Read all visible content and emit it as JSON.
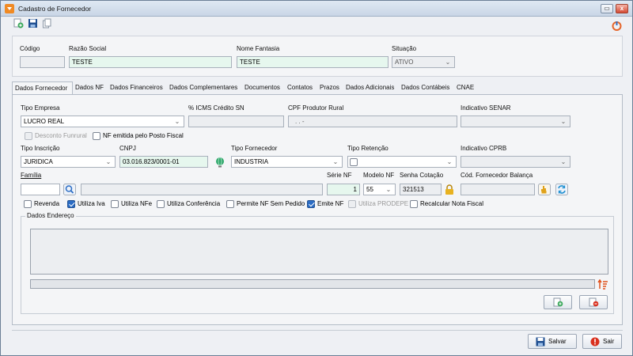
{
  "window": {
    "title": "Cadastro de Fornecedor",
    "restore_label": "▭",
    "close_label": "x"
  },
  "header": {
    "codigo": {
      "label": "Código",
      "value": ""
    },
    "razao": {
      "label": "Razão Social",
      "value": "TESTE"
    },
    "fantasia": {
      "label": "Nome Fantasia",
      "value": "TESTE"
    },
    "situacao": {
      "label": "Situação",
      "value": "ATIVO"
    }
  },
  "tabs": [
    "Dados Fornecedor",
    "Dados NF",
    "Dados Financeiros",
    "Dados Complementares",
    "Documentos",
    "Contatos",
    "Prazos",
    "Dados Adicionais",
    "Dados Contábeis",
    "CNAE"
  ],
  "form": {
    "tipo_empresa": {
      "label": "Tipo Empresa",
      "value": "LUCRO REAL"
    },
    "icms": {
      "label": "% ICMS Crédito SN",
      "value": ""
    },
    "cpf_produtor": {
      "label": "CPF Produtor Rural",
      "value": ". . -"
    },
    "senar": {
      "label": "Indicativo SENAR",
      "value": ""
    },
    "desconto_funrural": "Desconto Funrural",
    "nf_posto": "NF emitida pelo Posto Fiscal",
    "tipo_inscricao": {
      "label": "Tipo Inscrição",
      "value": "JURIDICA"
    },
    "cnpj": {
      "label": "CNPJ",
      "value": "03.016.823/0001-01"
    },
    "tipo_fornecedor": {
      "label": "Tipo Fornecedor",
      "value": "INDUSTRIA"
    },
    "tipo_retencao": {
      "label": "Tipo Retenção",
      "value": ""
    },
    "cprb": {
      "label": "Indicativo CPRB",
      "value": ""
    },
    "familia": {
      "label": "Família",
      "code": "",
      "desc": ""
    },
    "serie_nf": {
      "label": "Série NF",
      "value": "1"
    },
    "modelo_nf": {
      "label": "Modelo NF",
      "value": "55"
    },
    "senha_cotacao": {
      "label": "Senha Cotação",
      "value": "321513"
    },
    "cod_balanca": {
      "label": "Cód. Fornecedor Balança",
      "value": ""
    }
  },
  "checks": [
    {
      "label": "Revenda",
      "checked": false
    },
    {
      "label": "Utiliza Iva",
      "checked": true
    },
    {
      "label": "Utiliza NFe",
      "checked": false
    },
    {
      "label": "Utiliza Conferência",
      "checked": false
    },
    {
      "label": "Permite NF Sem Pedido",
      "checked": false
    },
    {
      "label": "Emite NF",
      "checked": true
    },
    {
      "label": "Utiliza PRODEPE",
      "checked": false,
      "disabled": true
    },
    {
      "label": "Recalcular Nota Fiscal",
      "checked": false
    }
  ],
  "endereco": {
    "title": "Dados Endereço"
  },
  "buttons": {
    "salvar": "Salvar",
    "sair": "Sair"
  },
  "colors": {
    "accent": "#2b6cc4",
    "green_field": "#e6f7ee",
    "orange": "#f08a24",
    "red": "#d9301e"
  }
}
